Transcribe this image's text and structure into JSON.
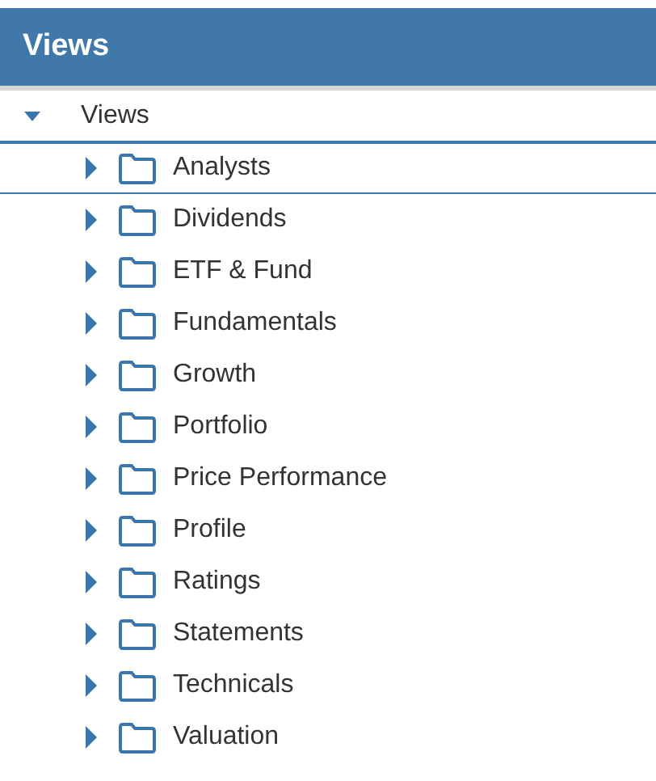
{
  "panel": {
    "title": "Views"
  },
  "tree": [
    {
      "label": "Views",
      "expanded": true,
      "selected": false,
      "children": [
        {
          "label": "Analysts",
          "expanded": false,
          "selected": true
        },
        {
          "label": "Dividends",
          "expanded": false,
          "selected": false
        },
        {
          "label": "ETF & Fund",
          "expanded": false,
          "selected": false
        },
        {
          "label": "Fundamentals",
          "expanded": false,
          "selected": false
        },
        {
          "label": "Growth",
          "expanded": false,
          "selected": false
        },
        {
          "label": "Portfolio",
          "expanded": false,
          "selected": false
        },
        {
          "label": "Price Performance",
          "expanded": false,
          "selected": false
        },
        {
          "label": "Profile",
          "expanded": false,
          "selected": false
        },
        {
          "label": "Ratings",
          "expanded": false,
          "selected": false
        },
        {
          "label": "Statements",
          "expanded": false,
          "selected": false
        },
        {
          "label": "Technicals",
          "expanded": false,
          "selected": false
        },
        {
          "label": "Valuation",
          "expanded": false,
          "selected": false
        }
      ]
    }
  ]
}
